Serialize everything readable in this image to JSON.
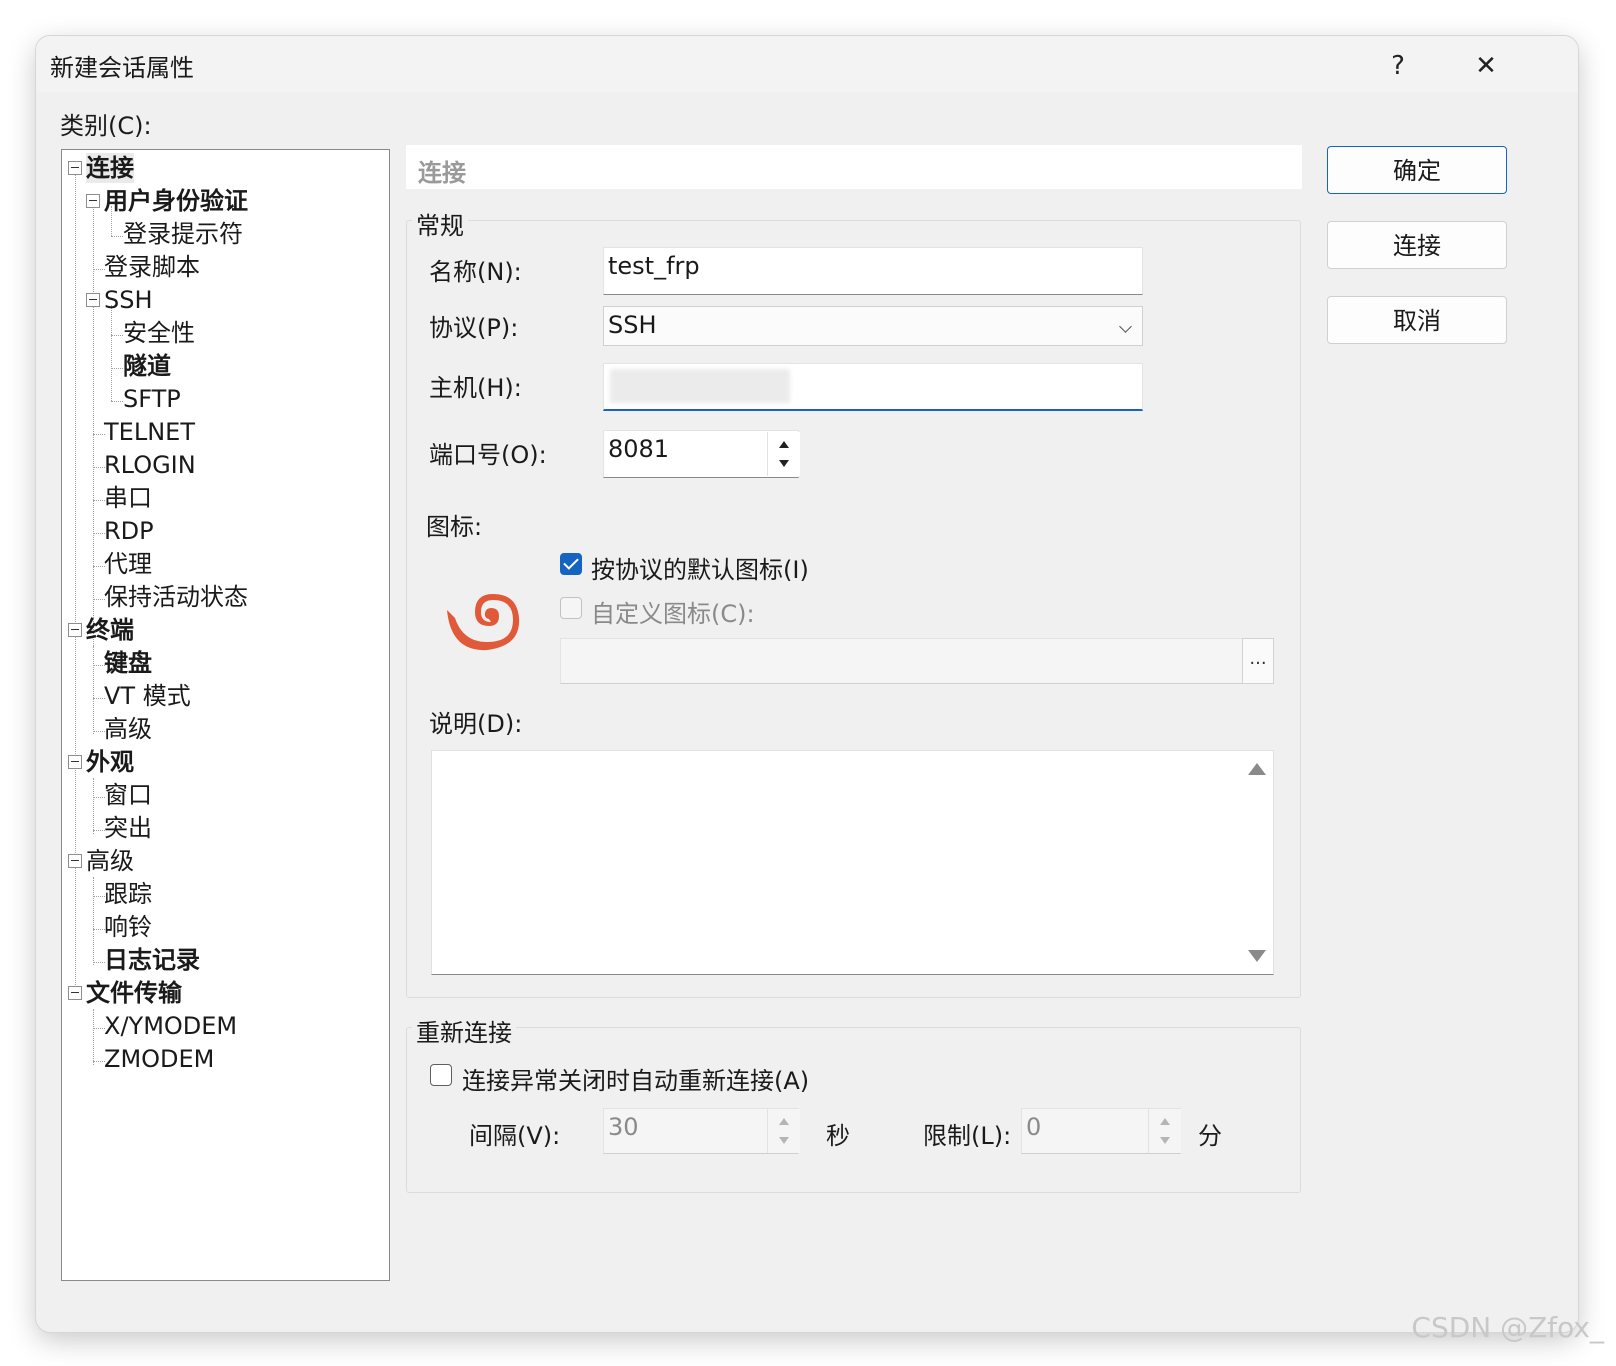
{
  "dialog": {
    "title": "新建会话属性",
    "help_label": "?",
    "close_label": "✕"
  },
  "category_label": "类别(C):",
  "tree": [
    {
      "label": "连接",
      "bold": true,
      "selected": true
    },
    {
      "label": "用户身份验证",
      "bold": true
    },
    {
      "label": "登录提示符"
    },
    {
      "label": "登录脚本"
    },
    {
      "label": "SSH"
    },
    {
      "label": "安全性"
    },
    {
      "label": "隧道",
      "bold": true
    },
    {
      "label": "SFTP"
    },
    {
      "label": "TELNET"
    },
    {
      "label": "RLOGIN"
    },
    {
      "label": "串口"
    },
    {
      "label": "RDP"
    },
    {
      "label": "代理"
    },
    {
      "label": "保持活动状态"
    },
    {
      "label": "终端",
      "bold": true
    },
    {
      "label": "键盘",
      "bold": true
    },
    {
      "label": "VT 模式"
    },
    {
      "label": "高级"
    },
    {
      "label": "外观",
      "bold": true
    },
    {
      "label": "窗口"
    },
    {
      "label": "突出"
    },
    {
      "label": "高级"
    },
    {
      "label": "跟踪"
    },
    {
      "label": "响铃"
    },
    {
      "label": "日志记录",
      "bold": true
    },
    {
      "label": "文件传输",
      "bold": true
    },
    {
      "label": "X/YMODEM"
    },
    {
      "label": "ZMODEM"
    }
  ],
  "section_header": "连接",
  "general": {
    "title": "常规",
    "name_label": "名称(N):",
    "name_value": "test_frp",
    "protocol_label": "协议(P):",
    "protocol_value": "SSH",
    "host_label": "主机(H):",
    "host_value": "",
    "port_label": "端口号(O):",
    "port_value": "8081",
    "icon_label": "图标:",
    "default_icon_label": "按协议的默认图标(I)",
    "default_icon_checked": true,
    "custom_icon_label": "自定义图标(C):",
    "custom_icon_checked": false,
    "custom_icon_path": "",
    "browse_label": "...",
    "desc_label": "说明(D):",
    "desc_value": ""
  },
  "reconnect": {
    "title": "重新连接",
    "auto_label": "连接异常关闭时自动重新连接(A)",
    "auto_checked": false,
    "interval_label": "间隔(V):",
    "interval_value": "30",
    "interval_unit": "秒",
    "limit_label": "限制(L):",
    "limit_value": "0",
    "limit_unit": "分"
  },
  "buttons": {
    "ok": "确定",
    "connect": "连接",
    "cancel": "取消"
  },
  "colors": {
    "accent": "#1565c0",
    "icon": "#e05a3a"
  },
  "watermark": "CSDN @Zfox_"
}
